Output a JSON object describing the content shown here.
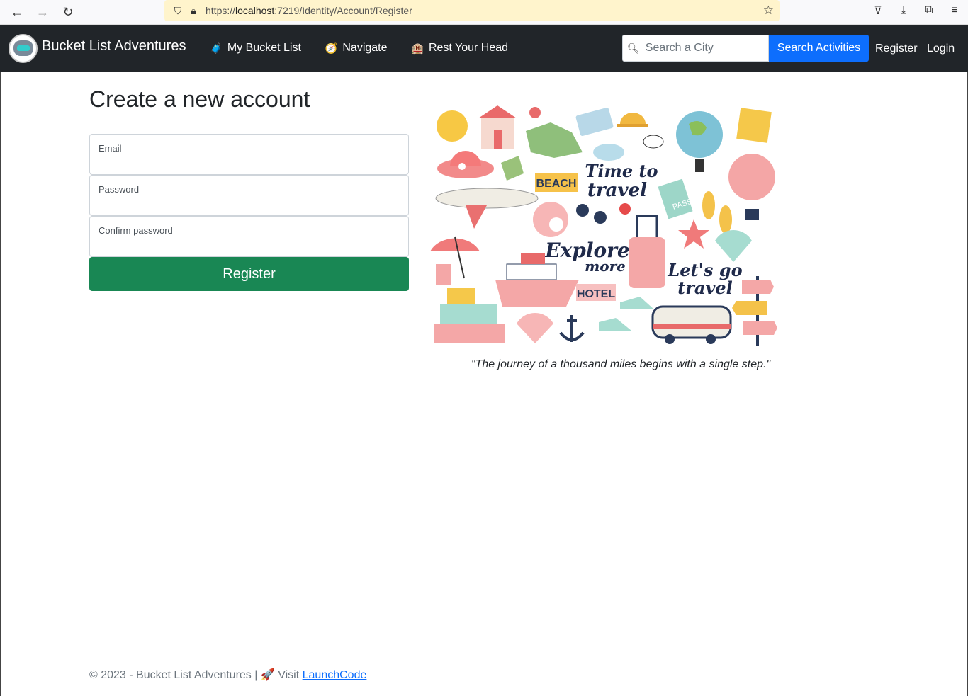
{
  "browser": {
    "url_prefix": "https://",
    "url_host": "localhost",
    "url_path": ":7219/Identity/Account/Register"
  },
  "navbar": {
    "brand": "Bucket List Adventures",
    "links": [
      {
        "icon": "🧳",
        "label": "My Bucket List"
      },
      {
        "icon": "🧭",
        "label": "Navigate"
      },
      {
        "icon": "🏨",
        "label": "Rest Your Head"
      }
    ],
    "search_placeholder": "Search a City",
    "search_button": "Search Activities",
    "register": "Register",
    "login": "Login"
  },
  "form": {
    "title": "Create a new account",
    "email_label": "Email",
    "password_label": "Password",
    "confirm_label": "Confirm password",
    "submit": "Register"
  },
  "illustration": {
    "texts": [
      "BEACH",
      "Time to",
      "travel",
      "Explore",
      "more",
      "HOTEL",
      "Let's go",
      "travel",
      "PASS"
    ]
  },
  "quote": "\"The journey of a thousand miles begins with a single step.\"",
  "footer": {
    "copyright": "© 2023 - Bucket List Adventures |",
    "rocket": "🚀",
    "visit": "Visit",
    "link": "LaunchCode"
  },
  "colors": {
    "navbar": "#212529",
    "primary": "#0d6efd",
    "success": "#198754"
  }
}
